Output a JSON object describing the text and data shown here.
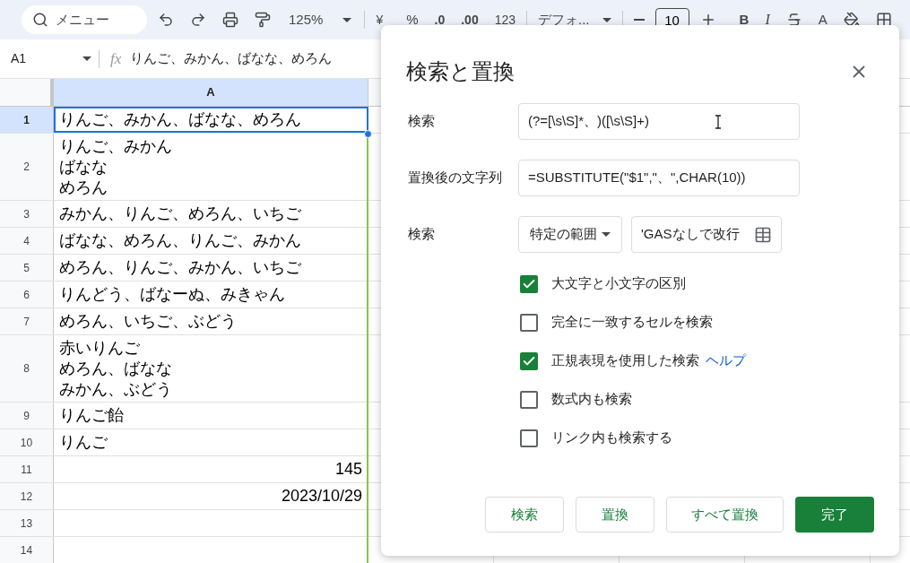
{
  "toolbar": {
    "menu_search": {
      "placeholder": "メニュー"
    },
    "zoom": "125%",
    "currency": "¥",
    "percent": "%",
    "decimal_decrease": ".0",
    "decimal_increase": ".00",
    "number_format": "123",
    "font": "デフォ...",
    "font_size": "10",
    "bold": "B",
    "italic": "I",
    "text_color": "A"
  },
  "formula_bar": {
    "cell_ref": "A1",
    "fx": "fx",
    "formula": "りんご、みかん、ばなな、めろん"
  },
  "grid": {
    "columns": [
      {
        "label": "A",
        "selected": true
      }
    ],
    "rows": [
      {
        "number": "1",
        "selected": true,
        "kind": "text",
        "text": "りんご、みかん、ばなな、めろん"
      },
      {
        "number": "2",
        "selected": false,
        "kind": "text",
        "lines": [
          "りんご、みかん",
          "ばなな",
          "めろん"
        ]
      },
      {
        "number": "3",
        "selected": false,
        "kind": "text",
        "text": "みかん、りんご、めろん、いちご"
      },
      {
        "number": "4",
        "selected": false,
        "kind": "text",
        "text": "ばなな、めろん、りんご、みかん"
      },
      {
        "number": "5",
        "selected": false,
        "kind": "text",
        "text": "めろん、りんご、みかん、いちご"
      },
      {
        "number": "6",
        "selected": false,
        "kind": "text",
        "text": "りんどう、ばなーぬ、みきゃん"
      },
      {
        "number": "7",
        "selected": false,
        "kind": "text",
        "text": "めろん、いちご、ぶどう"
      },
      {
        "number": "8",
        "selected": false,
        "kind": "text",
        "lines": [
          "赤いりんご",
          "めろん、ばなな",
          "みかん、ぶどう"
        ]
      },
      {
        "number": "9",
        "selected": false,
        "kind": "text",
        "text": "りんご飴"
      },
      {
        "number": "10",
        "selected": false,
        "kind": "text",
        "text": "りんご"
      },
      {
        "number": "11",
        "selected": false,
        "kind": "number",
        "text": "145"
      },
      {
        "number": "12",
        "selected": false,
        "kind": "number",
        "text": "2023/10/29"
      },
      {
        "number": "13",
        "selected": false,
        "kind": "empty"
      },
      {
        "number": "14",
        "selected": false,
        "kind": "empty"
      }
    ]
  },
  "dialog": {
    "title": "検索と置換",
    "fields": [
      {
        "label": "検索",
        "value": "(?=[\\s\\S]*、)([\\s\\S]+)"
      },
      {
        "label": "置換後の文字列",
        "value": "=SUBSTITUTE(\"$1\",\"、\",CHAR(10))"
      }
    ],
    "scope": {
      "label": "検索",
      "dropdown": "特定の範囲",
      "range": "'GASなしで改行"
    },
    "options": [
      {
        "label": "大文字と小文字の区別",
        "checked": true
      },
      {
        "label": "完全に一致するセルを検索",
        "checked": false
      },
      {
        "label": "正規表現を使用した検索",
        "checked": true,
        "help_link": "ヘルプ"
      },
      {
        "label": "数式内も検索",
        "checked": false
      },
      {
        "label": "リンク内も検索する",
        "checked": false
      }
    ],
    "buttons": [
      {
        "label": "検索",
        "primary": false
      },
      {
        "label": "置換",
        "primary": false
      },
      {
        "label": "すべて置換",
        "primary": false
      },
      {
        "label": "完了",
        "primary": true
      }
    ]
  }
}
